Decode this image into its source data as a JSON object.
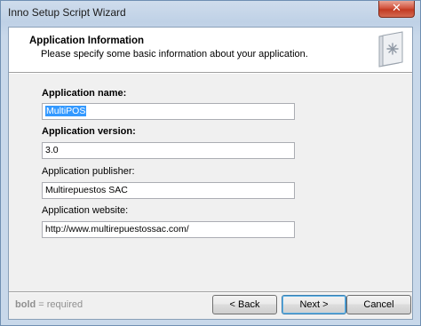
{
  "window": {
    "title": "Inno Setup Script Wizard",
    "close_glyph": "✕"
  },
  "header": {
    "title": "Application Information",
    "subtitle": "Please specify some basic information about your application.",
    "icon": "wizard-page-icon"
  },
  "form": {
    "app_name": {
      "label": "Application name:",
      "value": "MultiPOS",
      "required": true,
      "selected": true
    },
    "app_version": {
      "label": "Application version:",
      "value": "3.0",
      "required": true
    },
    "app_publisher": {
      "label": "Application publisher:",
      "value": "Multirepuestos SAC",
      "required": false
    },
    "app_website": {
      "label": "Application website:",
      "value": "http://www.multirepuestossac.com/",
      "required": false
    }
  },
  "footer": {
    "note_bold": "bold",
    "note_rest": " = required",
    "back_label": "< Back",
    "next_label": "Next >",
    "cancel_label": "Cancel"
  },
  "colors": {
    "selection": "#3399ff",
    "default_button_border": "#3c7fb1",
    "close_button": "#c23a22"
  }
}
